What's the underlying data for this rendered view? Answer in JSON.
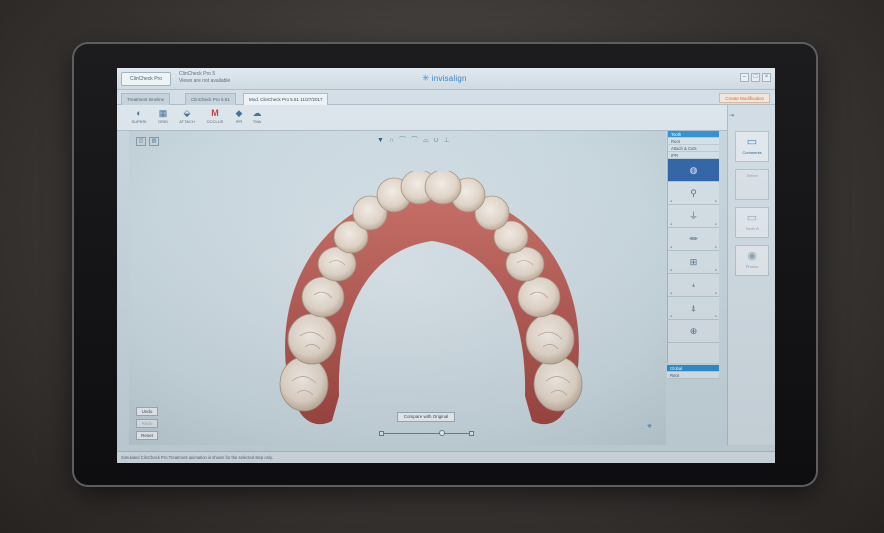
{
  "window": {
    "app_button": "ClinCheck Pro",
    "info_line1": "ClinCheck Pro 5",
    "info_line2": "Views are not available",
    "brand": "invisalign",
    "controls": [
      "–",
      "□",
      "×"
    ]
  },
  "tabs": [
    {
      "label": "Treatment timeline",
      "active": false
    },
    {
      "label": "ClinCheck Pro 5.61",
      "active": false
    },
    {
      "label": "Mod. ClinCheck Pro 5.61 11/27/2017",
      "active": true
    }
  ],
  "tab_right_label": "Create Modification",
  "toolbar": {
    "tools": [
      {
        "label": "SUPERI",
        "icon": "tooth-superimpose-icon",
        "glyph": "◐"
      },
      {
        "label": "GRID",
        "icon": "grid-icon",
        "glyph": "▦"
      },
      {
        "label": "ATTACH",
        "icon": "attachment-icon",
        "glyph": "⬙"
      },
      {
        "label": "OCCLUS",
        "icon": "occlusion-icon",
        "glyph": "M"
      },
      {
        "label": "IPR",
        "icon": "ipr-icon",
        "glyph": "◆"
      },
      {
        "label": "TMA",
        "icon": "tooth-movement-icon",
        "glyph": "☁"
      }
    ],
    "right_tool": {
      "label": "Tools",
      "glyph": "⅄"
    }
  },
  "viewport": {
    "view_icons": [
      "◫",
      "▥"
    ],
    "view_tools": [
      "▼",
      "∩",
      "⌒",
      "⌒",
      "⌓",
      "∪",
      "⊥"
    ],
    "undo": "Undo",
    "redo": "Redo",
    "reset": "Reset",
    "compare": "Compare with Original"
  },
  "staging": {
    "header": [
      "Tooth",
      "Root",
      "Attach & Cuts",
      "IPR"
    ],
    "stages": [
      {
        "glyph": "◍",
        "selected": true
      },
      {
        "glyph": "⚲",
        "selected": false
      },
      {
        "glyph": "⏚",
        "selected": false
      },
      {
        "glyph": "⏛",
        "selected": false
      },
      {
        "glyph": "⊞",
        "selected": false
      },
      {
        "glyph": "⍖",
        "selected": false
      },
      {
        "glyph": "⍋",
        "selected": false
      },
      {
        "glyph": "⊕",
        "selected": false
      }
    ],
    "footer": [
      "Global",
      "Root"
    ]
  },
  "right_panel": [
    {
      "label": "Comments",
      "glyph": "▭",
      "dim": false
    },
    {
      "label": "Select",
      "glyph": "",
      "dim": true
    },
    {
      "label": "Tooth B",
      "glyph": "▭",
      "dim": true
    },
    {
      "label": "Photos",
      "glyph": "◉",
      "dim": true
    }
  ],
  "status_text": "Simulated ClinCheck Pro Treatment animation is shown for the selected step only."
}
